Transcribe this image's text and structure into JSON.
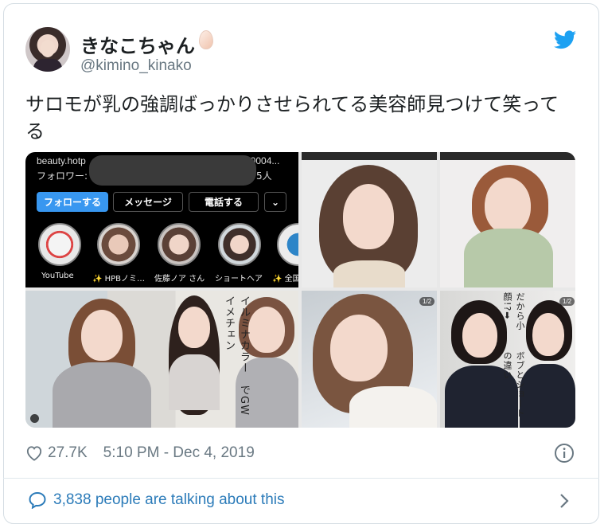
{
  "tweet": {
    "display_name": "きなこちゃん",
    "handle": "@kimino_kinako",
    "text": "サロモが乳の強調ばっかりさせられてる美容師見つけて笑ってる",
    "likes": "27.7K",
    "timestamp": "5:10 PM - Dec 4, 2019",
    "talking": "3,838 people are talking about this"
  },
  "media": {
    "instagram": {
      "url_prefix": "beauty.hotp",
      "url_suffix": "00004...",
      "followers_label": "フォロワー:",
      "followers_count_suffix": "5人",
      "follow_button": "フォローする",
      "message_button": "メッセージ",
      "call_button": "電話する",
      "more_button": "⌄",
      "stories": [
        "YouTube",
        "✨ HPBノミ…",
        "佐藤ノア さん",
        "ショートヘア",
        "✨ 全国"
      ]
    },
    "overlay_text_tile4": "イルミナカラー　でGWイメチェン",
    "overlay_text_tile6_a": "だから小顔!?➡",
    "overlay_text_tile6_b": "ボブとショートの違い",
    "badge_tile5": "1/2",
    "badge_tile6": "1/2"
  },
  "colors": {
    "twitter_blue": "#1da1f2",
    "link_blue": "#2b7bb9",
    "meta_gray": "#697882",
    "follow_blue": "#3897f0"
  },
  "icons": [
    "twitter-bird-icon",
    "heart-icon",
    "info-icon",
    "speech-bubble-icon",
    "chevron-right-icon",
    "egg-emoji-icon"
  ]
}
